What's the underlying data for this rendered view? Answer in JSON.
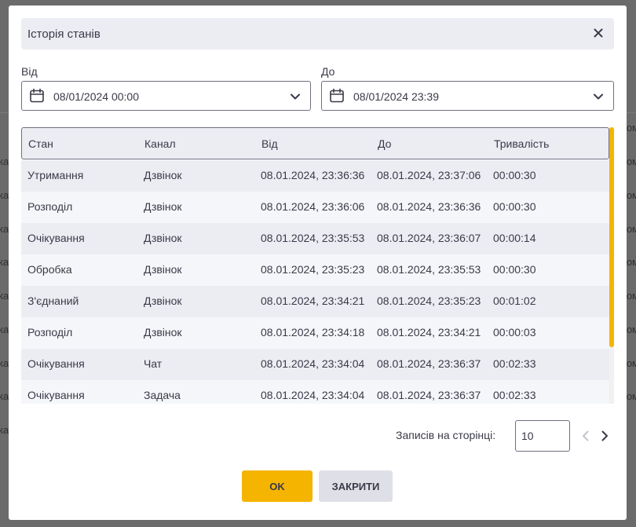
{
  "dialog": {
    "title": "Історія станів",
    "close_icon": "close-icon"
  },
  "filters": {
    "from_label": "Від",
    "from_value": "08/01/2024 00:00",
    "to_label": "До",
    "to_value": "08/01/2024 23:39",
    "calendar_icon": "calendar-icon",
    "dropdown_icon": "chevron-down-icon"
  },
  "table": {
    "headers": [
      "Стан",
      "Канал",
      "Від",
      "До",
      "Тривалість"
    ],
    "rows": [
      [
        "Утримання",
        "Дзвінок",
        "08.01.2024, 23:36:36",
        "08.01.2024, 23:37:06",
        "00:00:30"
      ],
      [
        "Розподіл",
        "Дзвінок",
        "08.01.2024, 23:36:06",
        "08.01.2024, 23:36:36",
        "00:00:30"
      ],
      [
        "Очікування",
        "Дзвінок",
        "08.01.2024, 23:35:53",
        "08.01.2024, 23:36:07",
        "00:00:14"
      ],
      [
        "Обробка",
        "Дзвінок",
        "08.01.2024, 23:35:23",
        "08.01.2024, 23:35:53",
        "00:00:30"
      ],
      [
        "З'єднаний",
        "Дзвінок",
        "08.01.2024, 23:34:21",
        "08.01.2024, 23:35:23",
        "00:01:02"
      ],
      [
        "Розподіл",
        "Дзвінок",
        "08.01.2024, 23:34:18",
        "08.01.2024, 23:34:21",
        "00:00:03"
      ],
      [
        "Очікування",
        "Чат",
        "08.01.2024, 23:34:04",
        "08.01.2024, 23:36:37",
        "00:02:33"
      ],
      [
        "Очікування",
        "Задача",
        "08.01.2024, 23:34:04",
        "08.01.2024, 23:36:37",
        "00:02:33"
      ]
    ]
  },
  "pagination": {
    "label": "Записів на сторінці:",
    "per_page": "10",
    "prev_icon": "chevron-left-icon",
    "next_icon": "chevron-right-icon"
  },
  "buttons": {
    "ok": "OK",
    "close": "ЗАКРИТИ"
  },
  "background": {
    "left_fragments": [
      "ка",
      "ка",
      "ка",
      "ка",
      "ка",
      "ка",
      "ка",
      "ка",
      "ка"
    ],
    "right_fragments": [
      "ом",
      "ом",
      "ом",
      "ом",
      "ом",
      "ом",
      "ом",
      "ом",
      "ом"
    ]
  },
  "colors": {
    "accent": "#f5b400",
    "header_bg": "#ecedf3",
    "text": "#3a3a48",
    "secondary_button": "#dfe0e7"
  }
}
